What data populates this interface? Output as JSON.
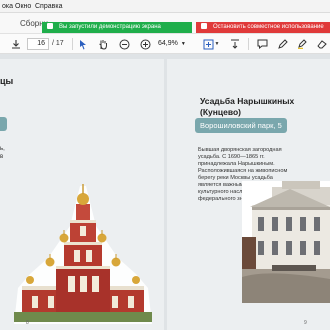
{
  "menu": {
    "items": [
      "ока",
      "Окно",
      "Справка"
    ]
  },
  "tab": {
    "label": "Сборни"
  },
  "banners": {
    "demo": "Вы запустили демонстрацию экрана",
    "stop": "Остановить совместное использование"
  },
  "toolbar": {
    "page_current": "16",
    "page_total": "/ 17",
    "zoom": "64,9%",
    "icons": [
      "print-icon",
      "save-icon",
      "upload-icon",
      "download-icon",
      "cursor-icon",
      "hand-icon",
      "zoom-out-icon",
      "zoom-in-icon",
      "fit-page-icon",
      "insert-icon",
      "comment-icon",
      "pen-icon",
      "highlight-icon",
      "eraser-icon"
    ]
  },
  "left_page": {
    "heading_fragment": "цы",
    "text_fragment": [
      "ь,",
      "в"
    ],
    "page_number": "8"
  },
  "right_page": {
    "heading": "Усадьба Нарышкиных (Кунцево)",
    "address_pill": "Ворошиловский парк, 5",
    "description": "Бывшая дворянская загородная усадьба. С 1690—1865 гг. принадлежала Нарышкиным. Расположившаяся на живописном берегу реки Москвы усадьба является важным объектом культурного наследия федерального значения.",
    "page_number": "9"
  },
  "colors": {
    "green": "#1fae4b",
    "red": "#e03a3a",
    "accent": "#7aa7ad"
  }
}
